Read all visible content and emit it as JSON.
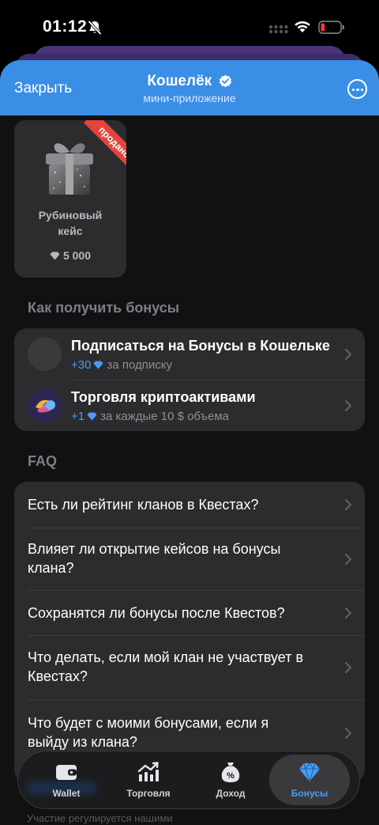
{
  "status_bar": {
    "time": "01:12"
  },
  "header": {
    "close_label": "Закрыть",
    "title": "Кошелёк",
    "subtitle": "мини-приложение"
  },
  "case_card": {
    "name_line1": "Рубиновый",
    "name_line2": "кейс",
    "badge": "продано",
    "price": "5 000"
  },
  "bonuses": {
    "section_title": "Как получить бонусы",
    "items": [
      {
        "title": "Подписаться на Бонусы в Кошельке",
        "amount": "+30",
        "desc": "за подписку"
      },
      {
        "title": "Торговля криптоактивами",
        "amount": "+1",
        "desc": "за каждые 10 $ объема"
      }
    ]
  },
  "faq": {
    "section_title": "FAQ",
    "items": [
      {
        "line1": "Есть ли рейтинг кланов в Квестах?",
        "line2": ""
      },
      {
        "line1": "Влияет ли открытие кейсов на бонусы",
        "line2": "клана?"
      },
      {
        "line1": "Сохранятся ли бонусы после Квестов?",
        "line2": ""
      },
      {
        "line1": "Что делать, если мой клан не участвует в",
        "line2": "Квестах?"
      },
      {
        "line1": "Что будет с моими бонусами, если я",
        "line2": "выйду из клана?"
      }
    ]
  },
  "footer_peek": "Участие регулируется нашими",
  "tabbar": {
    "tabs": [
      {
        "label": "Wallet",
        "icon": "wallet-icon",
        "active": false
      },
      {
        "label": "Торговля",
        "icon": "chart-up-icon",
        "active": false
      },
      {
        "label": "Доход",
        "icon": "money-bag-icon",
        "active": false
      },
      {
        "label": "Бонусы",
        "icon": "diamond-icon",
        "active": true
      }
    ]
  },
  "colors": {
    "header_bg": "#3a8ee6",
    "accent": "#4a9cf5",
    "badge_red": "#e5443c",
    "card_bg": "#2c2c2e",
    "page_bg": "#111113"
  }
}
